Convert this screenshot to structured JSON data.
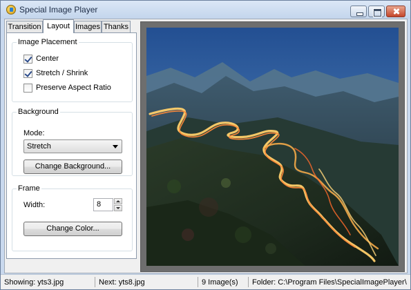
{
  "window": {
    "title": "Special Image Player"
  },
  "tabs": [
    {
      "label": "Transition"
    },
    {
      "label": "Layout",
      "selected": true
    },
    {
      "label": "Images"
    },
    {
      "label": "Thanks"
    }
  ],
  "image_placement": {
    "legend": "Image Placement",
    "options": [
      {
        "label": "Center",
        "checked": true
      },
      {
        "label": "Stretch / Shrink",
        "checked": true
      },
      {
        "label": "Preserve Aspect Ratio",
        "checked": false
      }
    ]
  },
  "background": {
    "legend": "Background",
    "mode_label": "Mode:",
    "mode_value": "Stretch",
    "change_button": "Change Background..."
  },
  "frame": {
    "legend": "Frame",
    "width_label": "Width:",
    "width_value": "8",
    "change_button": "Change Color..."
  },
  "status": {
    "showing": "Showing: yts3.jpg",
    "next": "Next: yts8.jpg",
    "count": "9 Image(s)",
    "folder": "Folder: C:\\Program Files\\SpecialImagePlayer\\"
  },
  "colors": {
    "titlebar": "#c9d9ee",
    "panel": "#f0f0f0",
    "frame_bg": "#6e6e6e",
    "sky": "#2c4a78"
  }
}
